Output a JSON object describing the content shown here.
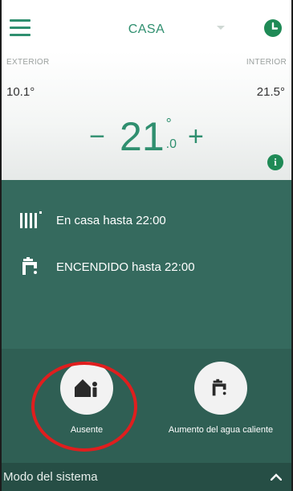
{
  "header": {
    "zone": "CASA",
    "menu_icon": "hamburger-menu-icon",
    "schedule_icon": "clock-icon",
    "accent_color": "#2f8f6f"
  },
  "temperatures": {
    "exterior_label": "EXTERIOR",
    "exterior_value": "10.1°",
    "interior_label": "INTERIOR",
    "interior_value": "21.5°",
    "setpoint_int": "21",
    "setpoint_degree": "°",
    "setpoint_decimal": ".0",
    "decrease_label": "−",
    "increase_label": "+",
    "info_label": "i"
  },
  "status": {
    "heating_text": "En casa hasta 22:00",
    "heating_icon": "radiator-icon",
    "water_text": "ENCENDIDO hasta 22:00",
    "water_icon": "tap-icon",
    "panel_color": "#356a5e"
  },
  "actions": [
    {
      "label": "Ausente",
      "icon": "house-person-icon"
    },
    {
      "label": "Aumento del agua caliente",
      "icon": "tap-icon"
    }
  ],
  "footer": {
    "mode_label": "Modo del sistema",
    "expand_icon": "chevron-up-icon"
  },
  "highlight_color": "#e01e1e"
}
